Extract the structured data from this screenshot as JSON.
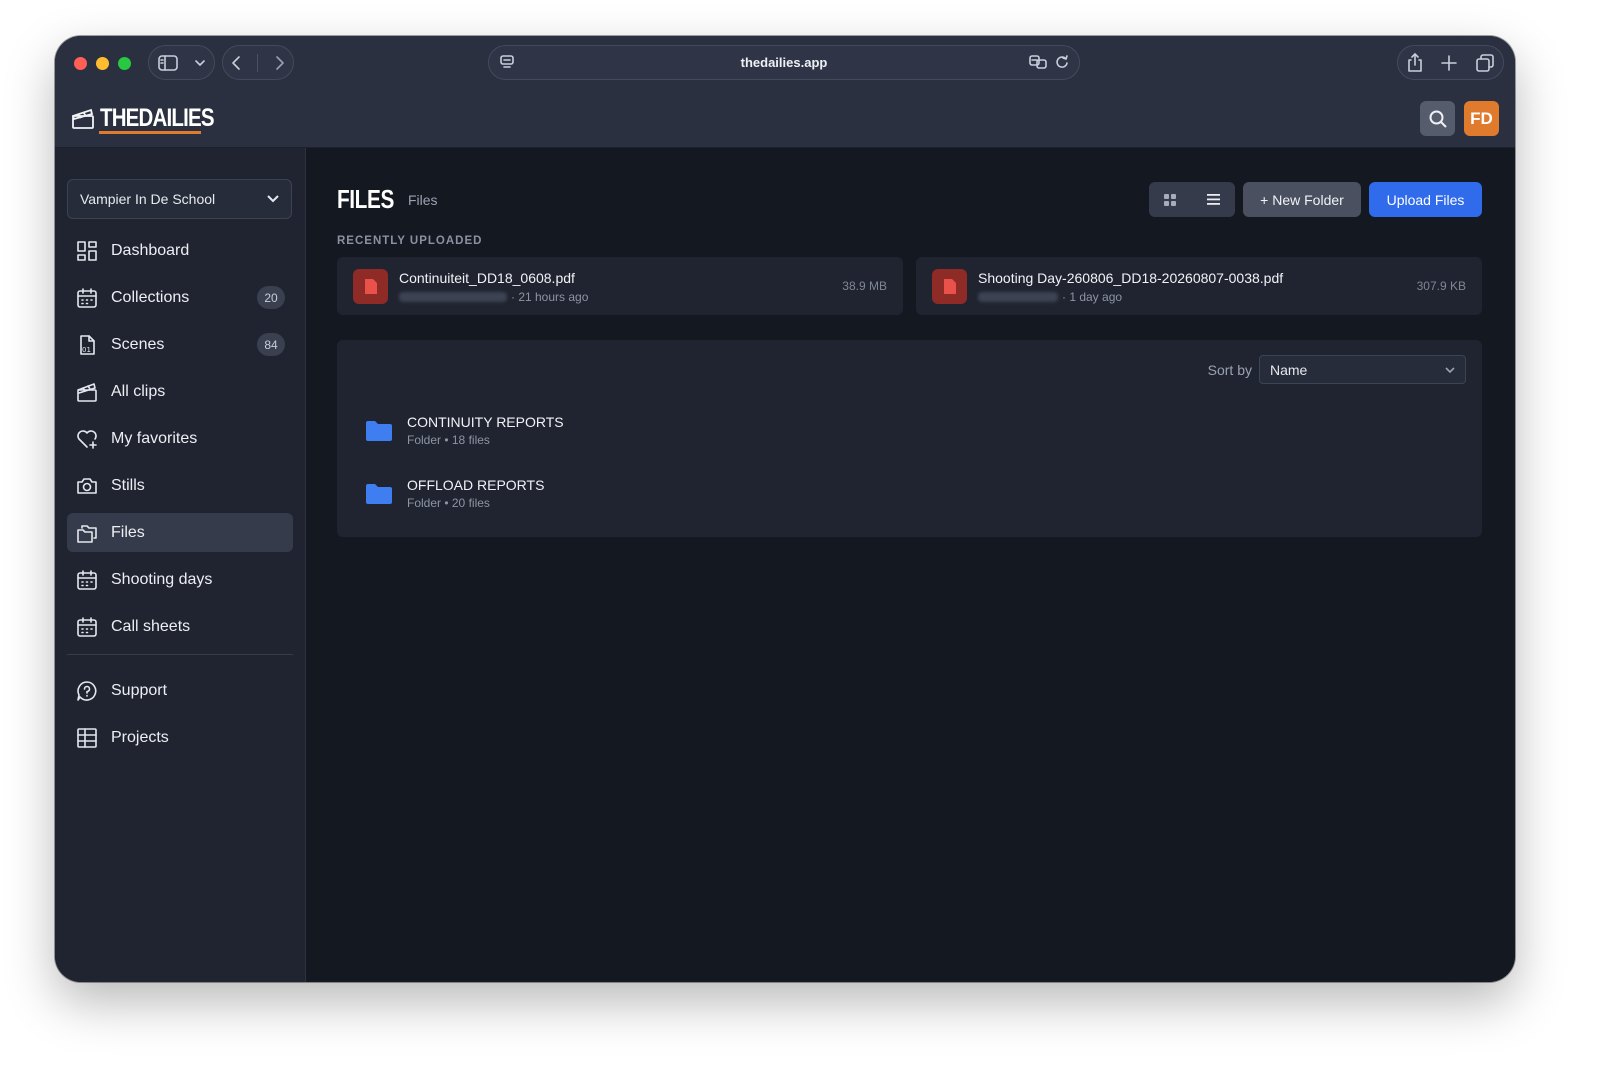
{
  "browser": {
    "url": "thedailies.app"
  },
  "header": {
    "logo_text": "THEDAILIES",
    "avatar_initials": "FD",
    "accent_color": "#e07b2e"
  },
  "sidebar": {
    "project": "Vampier In De School",
    "items": [
      {
        "label": "Dashboard",
        "icon": "dashboard-icon"
      },
      {
        "label": "Collections",
        "icon": "calendar-icon",
        "badge": "20"
      },
      {
        "label": "Scenes",
        "icon": "scene-file-icon",
        "badge": "84"
      },
      {
        "label": "All clips",
        "icon": "clapperboard-icon"
      },
      {
        "label": "My favorites",
        "icon": "heart-icon"
      },
      {
        "label": "Stills",
        "icon": "camera-icon"
      },
      {
        "label": "Files",
        "icon": "files-icon",
        "active": true
      },
      {
        "label": "Shooting days",
        "icon": "calendar-icon"
      },
      {
        "label": "Call sheets",
        "icon": "calendar-icon"
      }
    ],
    "bottom_items": [
      {
        "label": "Support",
        "icon": "help-bubble-icon"
      },
      {
        "label": "Projects",
        "icon": "grid-table-icon"
      }
    ]
  },
  "main": {
    "title": "FILES",
    "breadcrumb": "Files",
    "new_folder_label": "+ New Folder",
    "upload_label": "Upload Files",
    "recent_label": "RECENTLY UPLOADED",
    "recent": [
      {
        "name": "Continuiteit_DD18_0608.pdf",
        "time": "· 21 hours ago",
        "size": "38.9 MB"
      },
      {
        "name": "Shooting Day-260806_DD18-20260807-0038.pdf",
        "time": "· 1 day ago",
        "size": "307.9 KB"
      }
    ],
    "sort_label": "Sort by",
    "sort_value": "Name",
    "folders": [
      {
        "name": "CONTINUITY REPORTS",
        "meta": "Folder • 18 files"
      },
      {
        "name": "OFFLOAD REPORTS",
        "meta": "Folder • 20 files"
      }
    ],
    "primary_color": "#2f6bea",
    "folder_color": "#3f7ef0"
  }
}
